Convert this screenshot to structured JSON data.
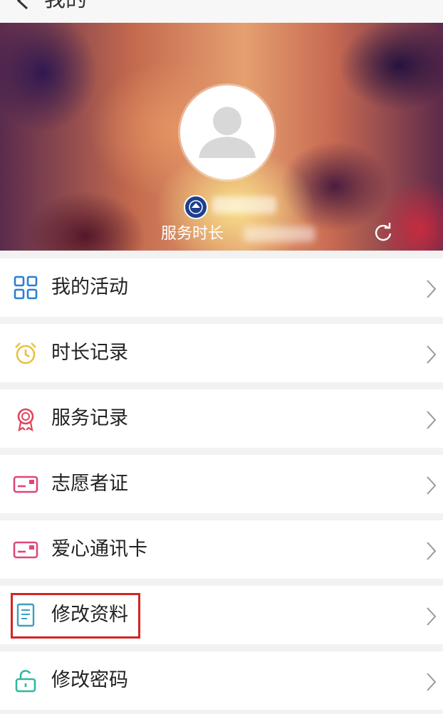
{
  "header": {
    "title": "我的",
    "back_icon": "chevron-left-icon"
  },
  "profile": {
    "duration_label": "服务时长",
    "refresh_icon": "refresh-icon"
  },
  "menu": {
    "items": [
      {
        "label": "我的活动",
        "icon": "grid-icon",
        "color": "#2a7fd0"
      },
      {
        "label": "时长记录",
        "icon": "alarm-clock-icon",
        "color": "#e8c23c"
      },
      {
        "label": "服务记录",
        "icon": "medal-icon",
        "color": "#e0455a"
      },
      {
        "label": "志愿者证",
        "icon": "id-card-icon",
        "color": "#e0457a"
      },
      {
        "label": "爱心通讯卡",
        "icon": "card-icon",
        "color": "#e0457a"
      },
      {
        "label": "修改资料",
        "icon": "document-icon",
        "color": "#3aa0c0"
      },
      {
        "label": "修改密码",
        "icon": "unlock-icon",
        "color": "#2fb8a0"
      }
    ]
  },
  "highlight_color": "#d42424"
}
